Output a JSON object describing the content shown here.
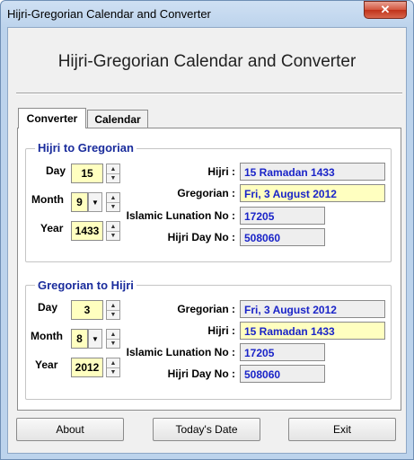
{
  "window": {
    "title": "Hijri-Gregorian Calendar and Converter",
    "close_glyph": "✕"
  },
  "app": {
    "title": "Hijri-Gregorian Calendar and Converter"
  },
  "tabs": [
    {
      "label": "Converter",
      "active": true
    },
    {
      "label": "Calendar",
      "active": false
    }
  ],
  "hijri_to_gregorian": {
    "title": "Hijri to Gregorian",
    "day_label": "Day",
    "day_value": "15",
    "month_label": "Month",
    "month_value": "9",
    "year_label": "Year",
    "year_value": "1433",
    "hijri_label": "Hijri :",
    "hijri_value": "15 Ramadan 1433",
    "gregorian_label": "Gregorian :",
    "gregorian_value": "Fri,  3  August  2012",
    "lunation_label": "Islamic Lunation No :",
    "lunation_value": "17205",
    "dayno_label": "Hijri Day No :",
    "dayno_value": "508060"
  },
  "gregorian_to_hijri": {
    "title": "Gregorian to Hijri",
    "day_label": "Day",
    "day_value": "3",
    "month_label": "Month",
    "month_value": "8",
    "year_label": "Year",
    "year_value": "2012",
    "gregorian_label": "Gregorian :",
    "gregorian_value": "Fri,  3 August 2012",
    "hijri_label": "Hijri :",
    "hijri_value": "15 Ramadan  1433",
    "lunation_label": "Islamic Lunation No :",
    "lunation_value": "17205",
    "dayno_label": "Hijri Day No :",
    "dayno_value": "508060"
  },
  "buttons": {
    "about": "About",
    "todays_date": "Today's Date",
    "exit": "Exit"
  },
  "colors": {
    "accent_text": "#1a24c8",
    "group_title": "#1a2c9c",
    "input_bg": "#ffffc0",
    "readonly_bg": "#eeeeee"
  }
}
